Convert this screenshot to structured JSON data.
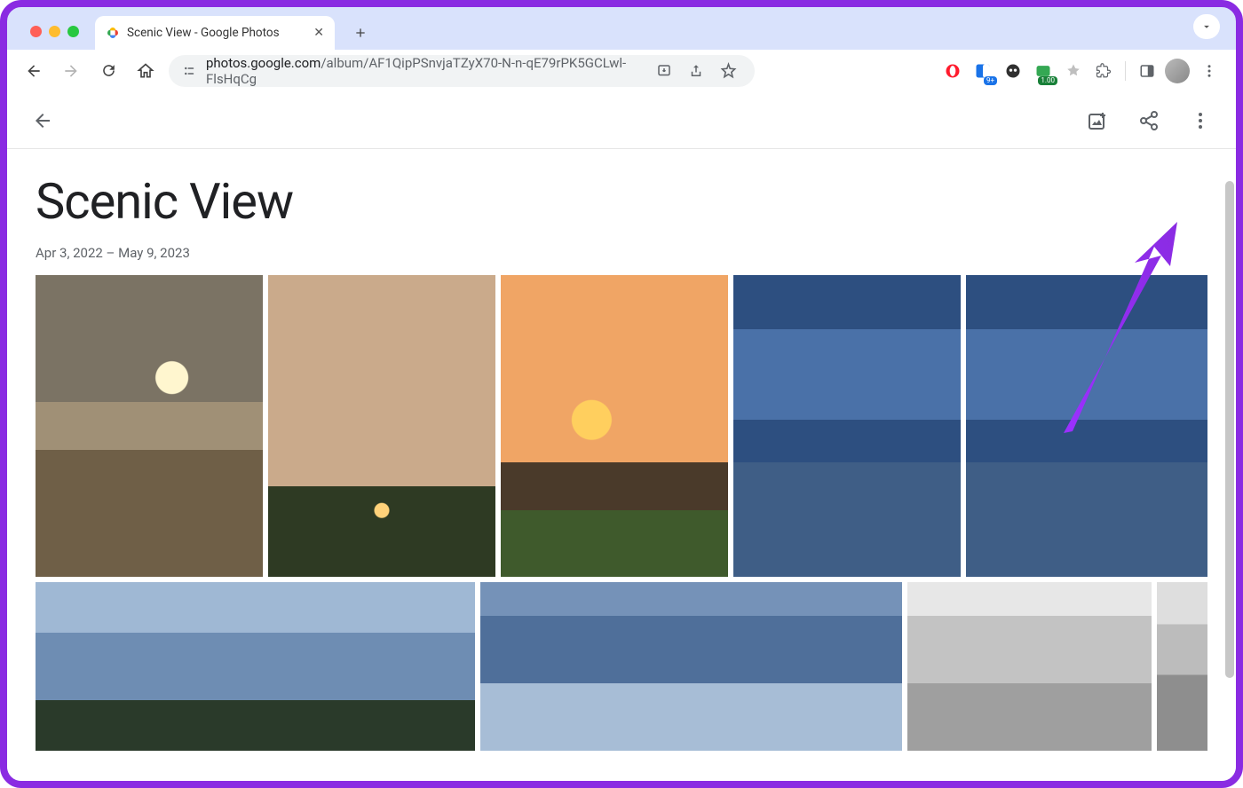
{
  "browser": {
    "tab_title": "Scenic View - Google Photos",
    "url_host": "photos.google.com",
    "url_path": "/album/AF1QipPSnvjaTZyX70-N-n-qE79rPK5GCLwl-FlsHqCg",
    "ext_badge_9plus": "9+",
    "ext_badge_100": "1.00"
  },
  "album": {
    "title": "Scenic View",
    "date_range": "Apr 3, 2022 – May 9, 2023"
  }
}
